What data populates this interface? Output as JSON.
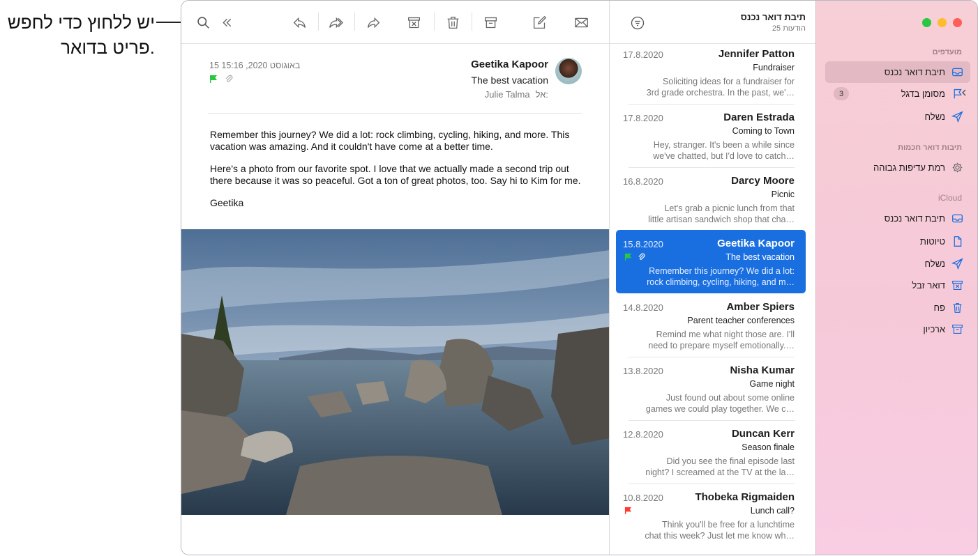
{
  "callout": {
    "line1": "יש ללחוץ כדי לחפש",
    "line2": "פריט בדואר."
  },
  "colors": {
    "accent": "#1a6fe0",
    "flag_green": "#28c840",
    "flag_red": "#ff3b30",
    "traffic_red": "#ff5f57",
    "traffic_yellow": "#febc2e",
    "traffic_green": "#28c840"
  },
  "sidebar": {
    "favorites_label": "מועדפים",
    "favorites": [
      {
        "label": "תיבת דואר נכנס",
        "icon": "inbox-icon",
        "selected": true
      },
      {
        "label": "מסומן בדגל",
        "icon": "flag-icon",
        "badge": "3"
      },
      {
        "label": "נשלח",
        "icon": "sent-icon"
      }
    ],
    "smart_label": "תיבות דואר חכמות",
    "smart": [
      {
        "label": "רמת עדיפות גבוהה",
        "icon": "gear-icon"
      }
    ],
    "icloud_label": "iCloud",
    "icloud": [
      {
        "label": "תיבת דואר נכנס",
        "icon": "inbox-icon"
      },
      {
        "label": "טיוטות",
        "icon": "document-icon"
      },
      {
        "label": "נשלח",
        "icon": "sent-icon"
      },
      {
        "label": "דואר זבל",
        "icon": "junk-icon"
      },
      {
        "label": "פח",
        "icon": "trash-icon"
      },
      {
        "label": "ארכיון",
        "icon": "archive-icon"
      }
    ]
  },
  "list": {
    "title": "תיבת דואר נכנס",
    "count": "25 הודעות",
    "messages": [
      {
        "from": "Jennifer Patton",
        "date": "17.8.2020",
        "subject": "Fundraiser",
        "preview1": "Soliciting ideas for a fundraiser for",
        "preview2": "3rd grade orchestra. In the past, we'…"
      },
      {
        "from": "Daren Estrada",
        "date": "17.8.2020",
        "subject": "Coming to Town",
        "preview1": "Hey, stranger. It's been a while since",
        "preview2": "we've chatted, but I'd love to catch…"
      },
      {
        "from": "Darcy Moore",
        "date": "16.8.2020",
        "subject": "Picnic",
        "preview1": "Let's grab a picnic lunch from that",
        "preview2": "little artisan sandwich shop that cha…"
      },
      {
        "from": "Geetika Kapoor",
        "date": "15.8.2020",
        "subject": "The best vacation",
        "preview1": "Remember this journey? We did a lot:",
        "preview2": "rock climbing, cycling, hiking, and m…",
        "selected": true,
        "flag": "green",
        "attachment": true
      },
      {
        "from": "Amber Spiers",
        "date": "14.8.2020",
        "subject": "Parent teacher conferences",
        "preview1": "Remind me what night those are. I'll",
        "preview2": "need to prepare myself emotionally.…"
      },
      {
        "from": "Nisha Kumar",
        "date": "13.8.2020",
        "subject": "Game night",
        "preview1": "Just found out about some online",
        "preview2": "games we could play together. We c…"
      },
      {
        "from": "Duncan Kerr",
        "date": "12.8.2020",
        "subject": "Season finale",
        "preview1": "Did you see the final episode last",
        "preview2": "night? I screamed at the TV at the la…"
      },
      {
        "from": "Thobeka Rigmaiden",
        "date": "10.8.2020",
        "subject": "Lunch call?",
        "preview1": "Think you'll be free for a lunchtime",
        "preview2": "chat this week? Just let me know wh…",
        "flag": "red"
      }
    ]
  },
  "message": {
    "from": "Geetika Kapoor",
    "subject": "The best vacation",
    "to_label": "אל:",
    "to": "Julie Talma",
    "date": "15 באוגוסט 2020, 15:16",
    "body": [
      "Remember this journey? We did a lot: rock climbing, cycling, hiking, and more. This vacation was amazing. And it couldn't have come at a better time.",
      "Here's a photo from our favorite spot. I love that we actually made a second trip out there because it was so peaceful. Got a ton of great photos, too. Say hi to Kim for me.",
      "Geetika"
    ]
  }
}
